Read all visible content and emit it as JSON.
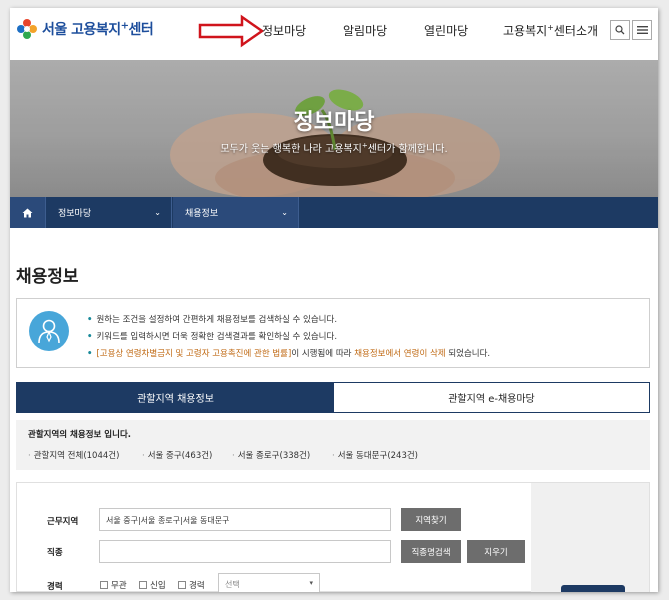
{
  "header": {
    "logo_text": "서울 고용복지",
    "logo_plus": "+",
    "logo_suffix": "센터",
    "nav": [
      {
        "label": "정보마당"
      },
      {
        "label": "알림마당"
      },
      {
        "label": "열린마당"
      },
      {
        "label_pre": "고용복지",
        "label_plus": "+",
        "label_post": "센터소개"
      }
    ],
    "search_icon": "search-icon",
    "menu_icon": "hamburger-menu-icon"
  },
  "hero": {
    "title": "정보마당",
    "subtitle_pre": "모두가 웃는 행복한 나라 고용복지",
    "subtitle_plus": "+",
    "subtitle_post": "센터가 함께합니다."
  },
  "subnav": {
    "home_icon": "home-icon",
    "items": [
      {
        "label": "정보마당"
      },
      {
        "label": "채용정보"
      }
    ]
  },
  "page": {
    "title": "채용정보"
  },
  "info": {
    "line1": "원하는 조건을 설정하여 간편하게 채용정보를 검색하실 수 있습니다.",
    "line2": "키워드를 입력하시면 더욱 정확한 검색결과를 확인하실 수 있습니다.",
    "line3_a": "[고용상 연령차별금지 및 고령자 고용촉진에 관한 법률]",
    "line3_b": "이 시행됨에 따라 ",
    "line3_c": "채용정보에서 연령이 삭제",
    "line3_d": " 되었습니다."
  },
  "tabs": {
    "active": "관할지역 채용정보",
    "inactive": "관할지역 e-채용마당"
  },
  "region": {
    "heading": "관할지역의 채용정보 입니다.",
    "links": [
      {
        "label": "관할지역 전체(1044건)"
      },
      {
        "label": "서울 중구(463건)"
      },
      {
        "label": "서울 종로구(338건)"
      },
      {
        "label": "서울 동대문구(243건)"
      }
    ]
  },
  "search": {
    "area_label": "근무지역",
    "area_value": "서울 중구|서울 종로구|서울 동대문구",
    "area_button": "지역찾기",
    "job_label": "직종",
    "job_value": "",
    "job_button": "직종명검색",
    "clear_button": "지우기",
    "career_label": "경력",
    "options": [
      {
        "label": "무관"
      },
      {
        "label": "신입"
      },
      {
        "label": "경력"
      }
    ],
    "select_placeholder": "선택"
  },
  "colors": {
    "navy": "#1d3a63",
    "logo_blue": "#1d4e9c",
    "info_icon": "#48a6d9",
    "accent_orange": "#c06a14",
    "annotation_arrow": "#d0141c"
  }
}
